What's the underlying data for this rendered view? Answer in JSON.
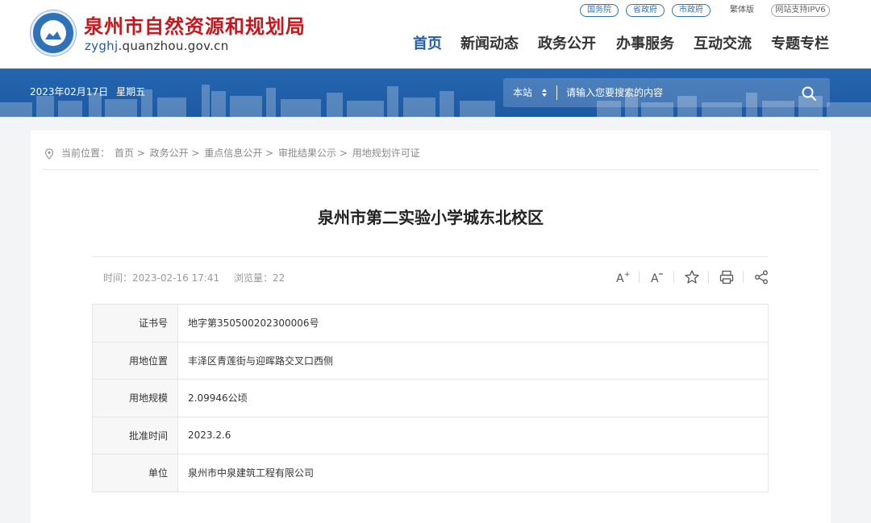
{
  "header": {
    "site_title": "泉州市自然资源和规划局",
    "site_domain_prefix": "zyghj",
    "site_domain_suffix": ".quanzhou.gov.cn",
    "top_links": [
      {
        "label": "国务院"
      },
      {
        "label": "省政府"
      },
      {
        "label": "市政府"
      }
    ],
    "traditional_label": "繁体版",
    "ipv6_label": "网站支持IPV6",
    "nav": [
      {
        "label": "首页",
        "active": true
      },
      {
        "label": "新闻动态"
      },
      {
        "label": "政务公开"
      },
      {
        "label": "办事服务"
      },
      {
        "label": "互动交流"
      },
      {
        "label": "专题专栏"
      }
    ]
  },
  "banner": {
    "date": "2023年02月17日",
    "weekday": "星期五",
    "search_scope": "本站",
    "search_placeholder": "请输入您要搜索的内容"
  },
  "breadcrumb": {
    "label": "当前位置：",
    "items": [
      "首页",
      "政务公开",
      "重点信息公开",
      "审批结果公示",
      "用地规划许可证"
    ],
    "separator": ">"
  },
  "article": {
    "title": "泉州市第二实验小学城东北校区",
    "time_label": "时间：",
    "time": "2023-02-16 17:41",
    "views_label": "浏览量：",
    "views": "22",
    "rows": [
      {
        "key": "证书号",
        "value": "地字第350500202300006号"
      },
      {
        "key": "用地位置",
        "value": "丰泽区青莲街与迎晖路交叉口西侧"
      },
      {
        "key": "用地规模",
        "value": "2.09946公顷"
      },
      {
        "key": "批准时间",
        "value": "2023.2.6"
      },
      {
        "key": "单位",
        "value": "泉州市中泉建筑工程有限公司"
      }
    ]
  },
  "tools": [
    "font-increase-icon",
    "font-decrease-icon",
    "star-icon",
    "print-icon",
    "share-icon"
  ],
  "colors": {
    "brand_red": "#c8161d",
    "brand_blue": "#1f5da8",
    "banner_blue": "#2566b0"
  }
}
